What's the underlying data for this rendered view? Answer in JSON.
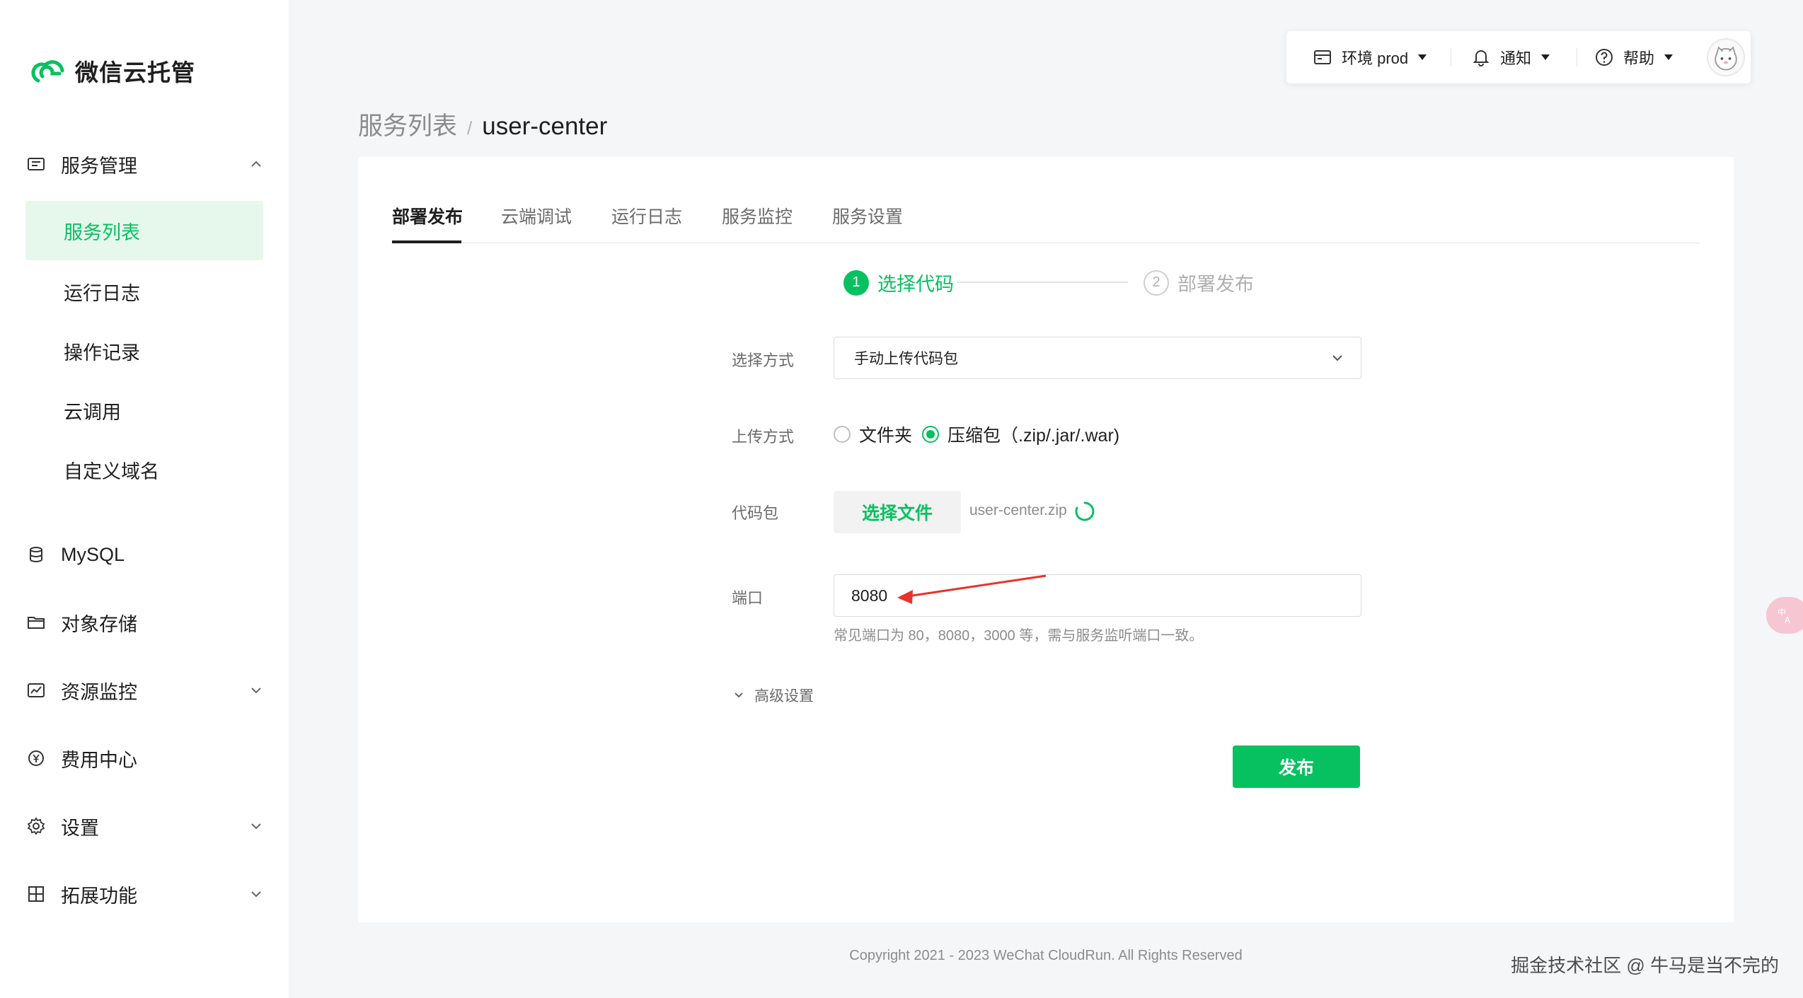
{
  "app": {
    "name": "微信云托管"
  },
  "sidebar": {
    "groups": [
      {
        "label": "服务管理",
        "icon": "service-icon",
        "expanded": true
      },
      {
        "label": "MySQL",
        "icon": "database-icon"
      },
      {
        "label": "对象存储",
        "icon": "folder-icon"
      },
      {
        "label": "资源监控",
        "icon": "monitor-icon",
        "expanded": false
      },
      {
        "label": "费用中心",
        "icon": "yen-icon"
      },
      {
        "label": "设置",
        "icon": "gear-icon",
        "expanded": false
      },
      {
        "label": "拓展功能",
        "icon": "extension-icon",
        "expanded": false
      }
    ],
    "sub_items": [
      {
        "label": "服务列表",
        "active": true
      },
      {
        "label": "运行日志"
      },
      {
        "label": "操作记录"
      },
      {
        "label": "云调用"
      },
      {
        "label": "自定义域名"
      }
    ]
  },
  "toolbar": {
    "env_label": "环境 prod",
    "notify_label": "通知",
    "help_label": "帮助"
  },
  "breadcrumb": {
    "parent": "服务列表",
    "separator": "/",
    "current": "user-center"
  },
  "tabs": [
    "部署发布",
    "云端调试",
    "运行日志",
    "服务监控",
    "服务设置"
  ],
  "active_tab": "部署发布",
  "steps": [
    {
      "number": "1",
      "label": "选择代码",
      "active": true
    },
    {
      "number": "2",
      "label": "部署发布",
      "active": false
    }
  ],
  "form": {
    "method_label": "选择方式",
    "method_value": "手动上传代码包",
    "upload_label": "上传方式",
    "upload_options": [
      "文件夹",
      "压缩包（.zip/.jar/.war)"
    ],
    "upload_selected": "压缩包（.zip/.jar/.war)",
    "package_label": "代码包",
    "choose_file_label": "选择文件",
    "file_name": "user-center.zip",
    "port_label": "端口",
    "port_value": "8080",
    "port_hint": "常见端口为 80，8080，3000 等，需与服务监听端口一致。",
    "advanced_label": "高级设置",
    "publish_label": "发布"
  },
  "footer": {
    "copyright": "Copyright 2021 - 2023 WeChat CloudRun. All Rights Reserved"
  },
  "watermark": "掘金技术社区 @ 牛马是当不完的",
  "colors": {
    "accent": "#07c160",
    "annotation_arrow": "#e8332a"
  }
}
